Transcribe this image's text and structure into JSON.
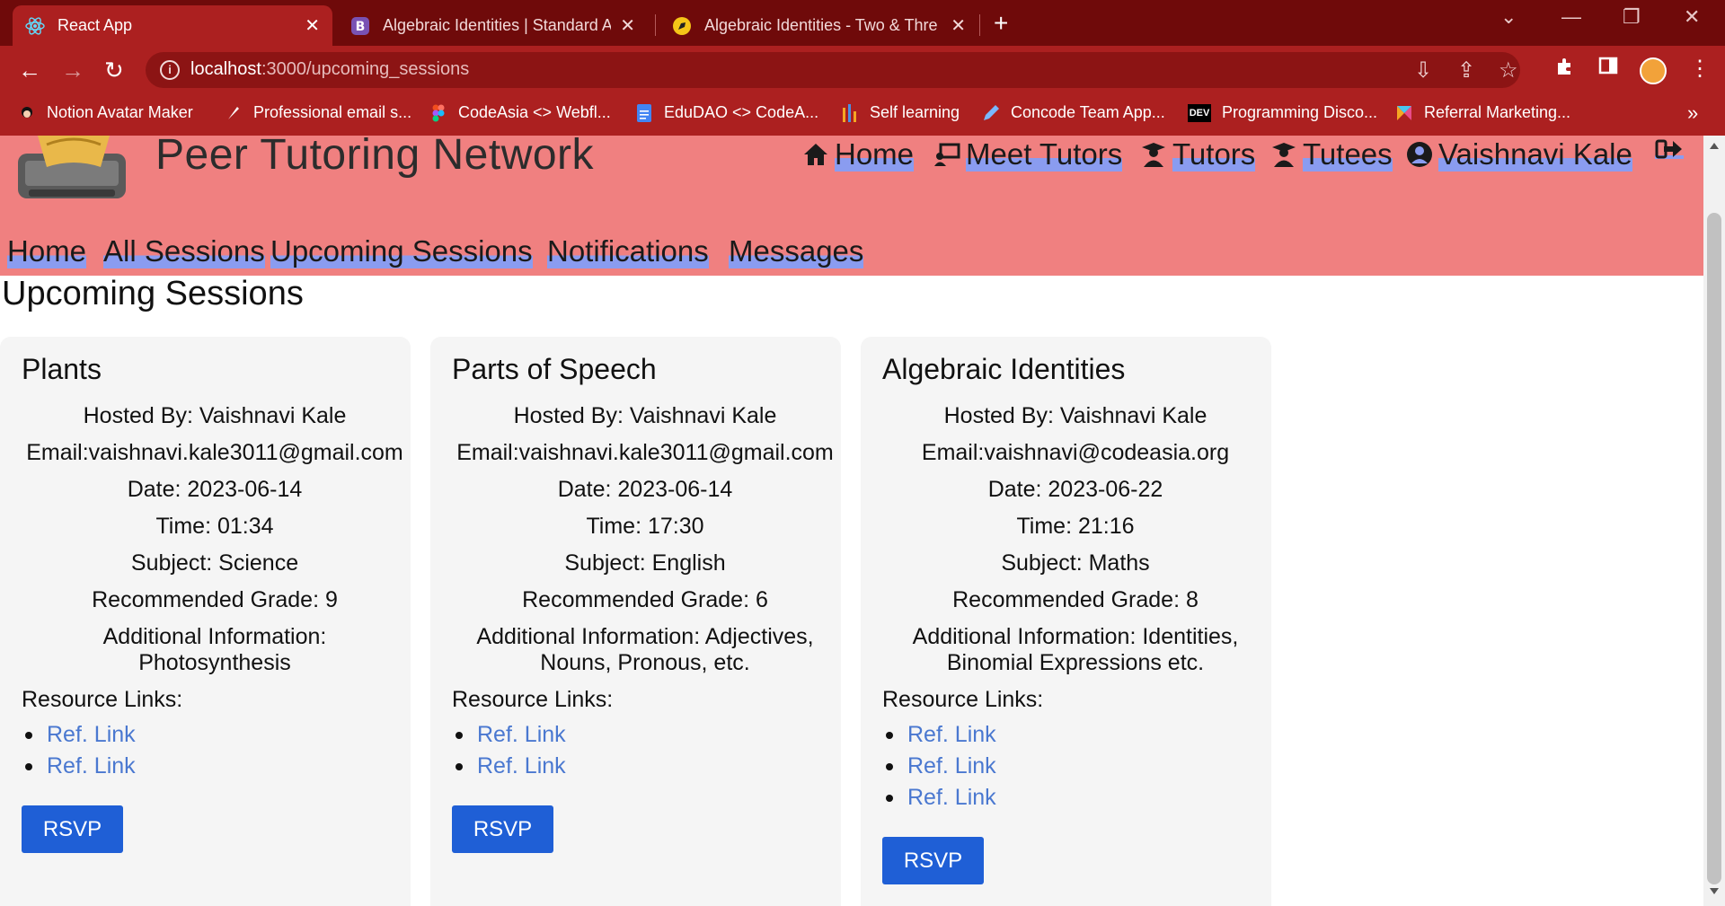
{
  "browser": {
    "tabs": [
      {
        "title": "React App",
        "close": "✕"
      },
      {
        "title": "Algebraic Identities | Standard Al",
        "close": "✕"
      },
      {
        "title": "Algebraic Identities - Two & Thre",
        "close": "✕"
      }
    ],
    "new_tab": "+",
    "address": {
      "host": "localhost",
      "path": ":3000/upcoming_sessions"
    },
    "bookmarks": [
      {
        "label": "Notion Avatar Maker"
      },
      {
        "label": "Professional email s..."
      },
      {
        "label": "CodeAsia <> Webfl..."
      },
      {
        "label": "EduDAO <> CodeA..."
      },
      {
        "label": "Self learning"
      },
      {
        "label": "Concode Team App..."
      },
      {
        "label": "Programming Disco...",
        "icon_text": "DEV"
      },
      {
        "label": "Referral Marketing..."
      }
    ],
    "bookmarks_more": "»"
  },
  "site": {
    "brand": "Peer Tutoring Network",
    "topnav": {
      "home": "Home",
      "meet_tutors": "Meet Tutors",
      "tutors": "Tutors",
      "tutees": "Tutees",
      "user": "Vaishnavi Kale"
    },
    "subnav": {
      "home": "Home",
      "all_sessions": "All Sessions",
      "upcoming_sessions": "Upcoming Sessions",
      "notifications": "Notifications",
      "messages": "Messages"
    }
  },
  "page": {
    "title": "Upcoming Sessions"
  },
  "sessions": [
    {
      "title": "Plants",
      "hosted_by": "Hosted By: Vaishnavi Kale",
      "email": "Email:vaishnavi.kale3011@gmail.com",
      "date": "Date: 2023-06-14",
      "time": "Time: 01:34",
      "subject": "Subject: Science",
      "grade": "Recommended Grade: 9",
      "info_1": "Additional Information:",
      "info_2": "Photosynthesis",
      "resources_label": "Resource Links:",
      "links": [
        "Ref. Link",
        "Ref. Link"
      ],
      "rsvp": "RSVP"
    },
    {
      "title": "Parts of Speech",
      "hosted_by": "Hosted By: Vaishnavi Kale",
      "email": "Email:vaishnavi.kale3011@gmail.com",
      "date": "Date: 2023-06-14",
      "time": "Time: 17:30",
      "subject": "Subject: English",
      "grade": "Recommended Grade: 6",
      "info_1": "Additional Information: Adjectives,",
      "info_2": "Nouns, Pronous, etc.",
      "resources_label": "Resource Links:",
      "links": [
        "Ref. Link",
        "Ref. Link"
      ],
      "rsvp": "RSVP"
    },
    {
      "title": "Algebraic Identities",
      "hosted_by": "Hosted By: Vaishnavi Kale",
      "email": "Email:vaishnavi@codeasia.org",
      "date": "Date: 2023-06-22",
      "time": "Time: 21:16",
      "subject": "Subject: Maths",
      "grade": "Recommended Grade: 8",
      "info_1": "Additional Information: Identities,",
      "info_2": "Binomial Expressions etc.",
      "resources_label": "Resource Links:",
      "links": [
        "Ref. Link",
        "Ref. Link",
        "Ref. Link"
      ],
      "rsvp": "RSVP"
    }
  ],
  "colors": {
    "tab_strip": "#6f0a0a",
    "toolbar": "#ac2020",
    "header_bg": "#f08080",
    "nav_highlight": "#8a9cf0",
    "link": "#4a78d0",
    "rsvp_button": "#1f5fd6",
    "card_bg": "#f5f5f5"
  },
  "icons": {
    "tab1": "react-logo-icon",
    "tab2": "bootstrap-logo-icon",
    "tab3": "rocket-icon",
    "home": "house-icon",
    "meet_tutors": "chalkboard-teacher-icon",
    "tutors": "graduate-icon",
    "tutees": "graduate-icon",
    "user": "user-circle-icon",
    "logout": "sign-out-icon"
  }
}
